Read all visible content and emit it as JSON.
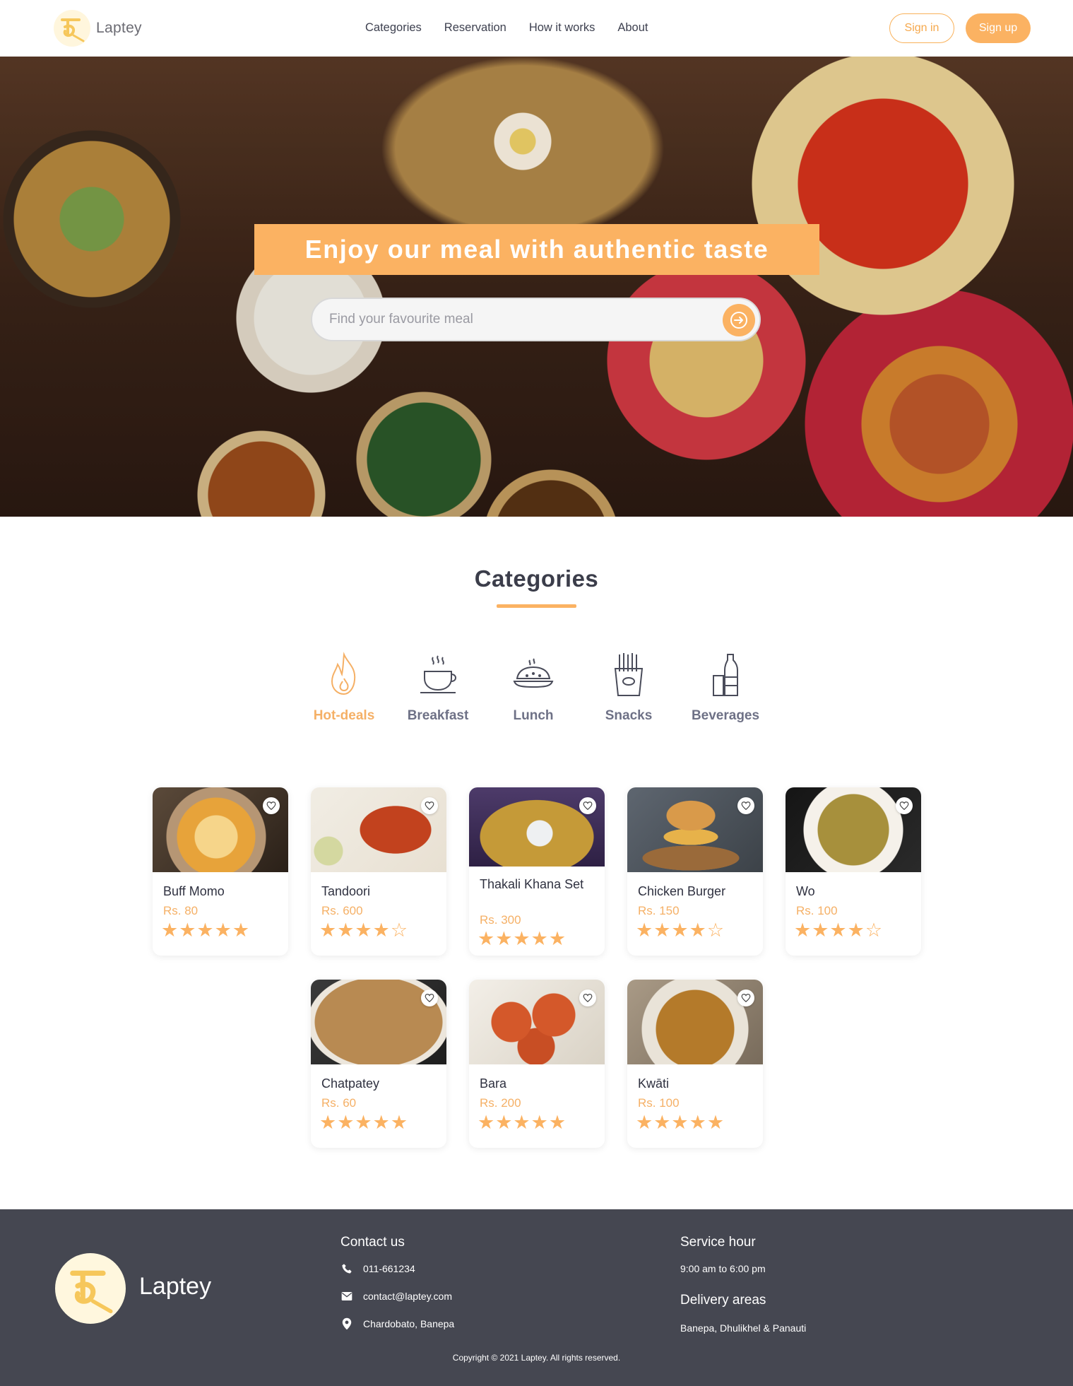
{
  "header": {
    "brand": "Laptey",
    "nav": [
      "Categories",
      "Reservation",
      "How it works",
      "About"
    ],
    "sign_in": "Sign in",
    "sign_up": "Sign up"
  },
  "hero": {
    "title": "Enjoy our meal with authentic taste",
    "search_placeholder": "Find your favourite meal"
  },
  "categories": {
    "heading": "Categories",
    "items": [
      {
        "label": "Hot-deals",
        "icon": "flame-icon",
        "active": true
      },
      {
        "label": "Breakfast",
        "icon": "coffee-cup-icon",
        "active": false
      },
      {
        "label": "Lunch",
        "icon": "dish-icon",
        "active": false
      },
      {
        "label": "Snacks",
        "icon": "fries-icon",
        "active": false
      },
      {
        "label": "Beverages",
        "icon": "bottle-icon",
        "active": false
      }
    ]
  },
  "meals": [
    {
      "name": "Buff Momo",
      "price": "Rs. 80",
      "rating": 5
    },
    {
      "name": "Tandoori",
      "price": "Rs. 600",
      "rating": 4
    },
    {
      "name": "Thakali Khana Set",
      "price": "Rs. 300",
      "rating": 5
    },
    {
      "name": "Chicken Burger",
      "price": "Rs. 150",
      "rating": 4
    },
    {
      "name": "Wo",
      "price": "Rs. 100",
      "rating": 4
    },
    {
      "name": "Chatpatey",
      "price": "Rs. 60",
      "rating": 5
    },
    {
      "name": "Bara",
      "price": "Rs. 200",
      "rating": 5
    },
    {
      "name": "Kwāti",
      "price": "Rs. 100",
      "rating": 5
    }
  ],
  "footer": {
    "brand": "Laptey",
    "contact_heading": "Contact us",
    "phone": "011-661234",
    "email": "contact@laptey.com",
    "address": "Chardobato, Banepa",
    "service_heading": "Service hour",
    "service_hours": "9:00 am to 6:00 pm",
    "delivery_heading": "Delivery areas",
    "delivery_areas": "Banepa, Dhulikhel & Panauti",
    "copyright": "Copyright © 2021 Laptey. All rights reserved."
  },
  "colors": {
    "accent": "#fbb262",
    "text_dark": "#3b3d4a",
    "footer_bg": "#454751"
  }
}
